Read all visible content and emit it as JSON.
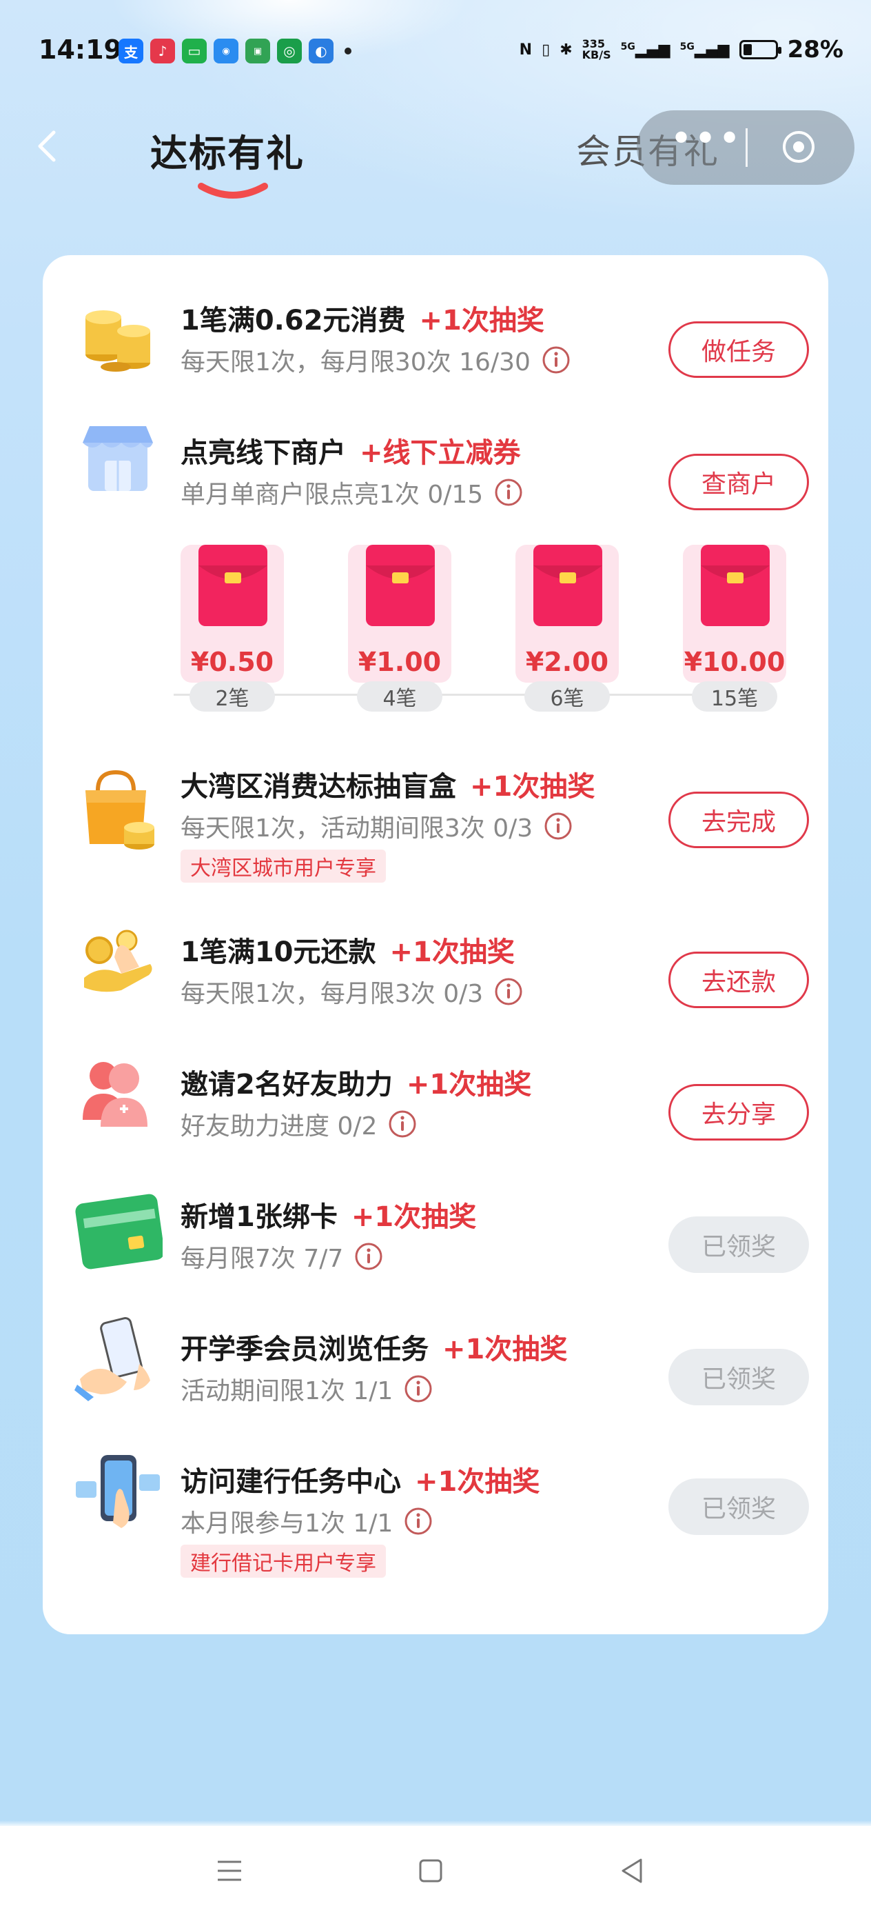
{
  "status_bar": {
    "time": "14:19",
    "net_speed_top": "335",
    "net_speed_unit": "KB/S",
    "signal_1": "5G",
    "signal_2": "5G",
    "battery_percent": "28%",
    "battery_level": 0.28
  },
  "header": {
    "active_tab": "达标有礼",
    "other_tab": "会员有礼"
  },
  "tasks": [
    {
      "title": "1笔满0.62元消费",
      "reward": "+1次抽奖",
      "desc": "每天限1次，每月限30次 16/30",
      "button": "做任务",
      "state": "active"
    },
    {
      "title": "点亮线下商户",
      "reward": "+线下立减券",
      "desc": "单月单商户限点亮1次 0/15",
      "button": "查商户",
      "state": "active"
    },
    {
      "title": "大湾区消费达标抽盲盒",
      "reward": "+1次抽奖",
      "desc": "每天限1次，活动期间限3次 0/3",
      "tag": "大湾区城市用户专享",
      "button": "去完成",
      "state": "active"
    },
    {
      "title": "1笔满10元还款",
      "reward": "+1次抽奖",
      "desc": "每天限1次，每月限3次 0/3",
      "button": "去还款",
      "state": "active"
    },
    {
      "title": "邀请2名好友助力",
      "reward": "+1次抽奖",
      "desc": "好友助力进度 0/2",
      "button": "去分享",
      "state": "active"
    },
    {
      "title": "新增1张绑卡",
      "reward": "+1次抽奖",
      "desc": "每月限7次 7/7",
      "button": "已领奖",
      "state": "done"
    },
    {
      "title": "开学季会员浏览任务",
      "reward": "+1次抽奖",
      "desc": "活动期间限1次 1/1",
      "button": "已领奖",
      "state": "done"
    },
    {
      "title": "访问建行任务中心",
      "reward": "+1次抽奖",
      "desc": "本月限参与1次 1/1",
      "tag": "建行借记卡用户专享",
      "button": "已领奖",
      "state": "done"
    }
  ],
  "envelopes": [
    {
      "amount": "¥0.50",
      "count": "2笔"
    },
    {
      "amount": "¥1.00",
      "count": "4笔"
    },
    {
      "amount": "¥2.00",
      "count": "6笔"
    },
    {
      "amount": "¥10.00",
      "count": "15笔"
    }
  ],
  "colors": {
    "accent_red": "#e3383f",
    "background_blue": "#b8def9",
    "done_button": "#e9ecef"
  }
}
